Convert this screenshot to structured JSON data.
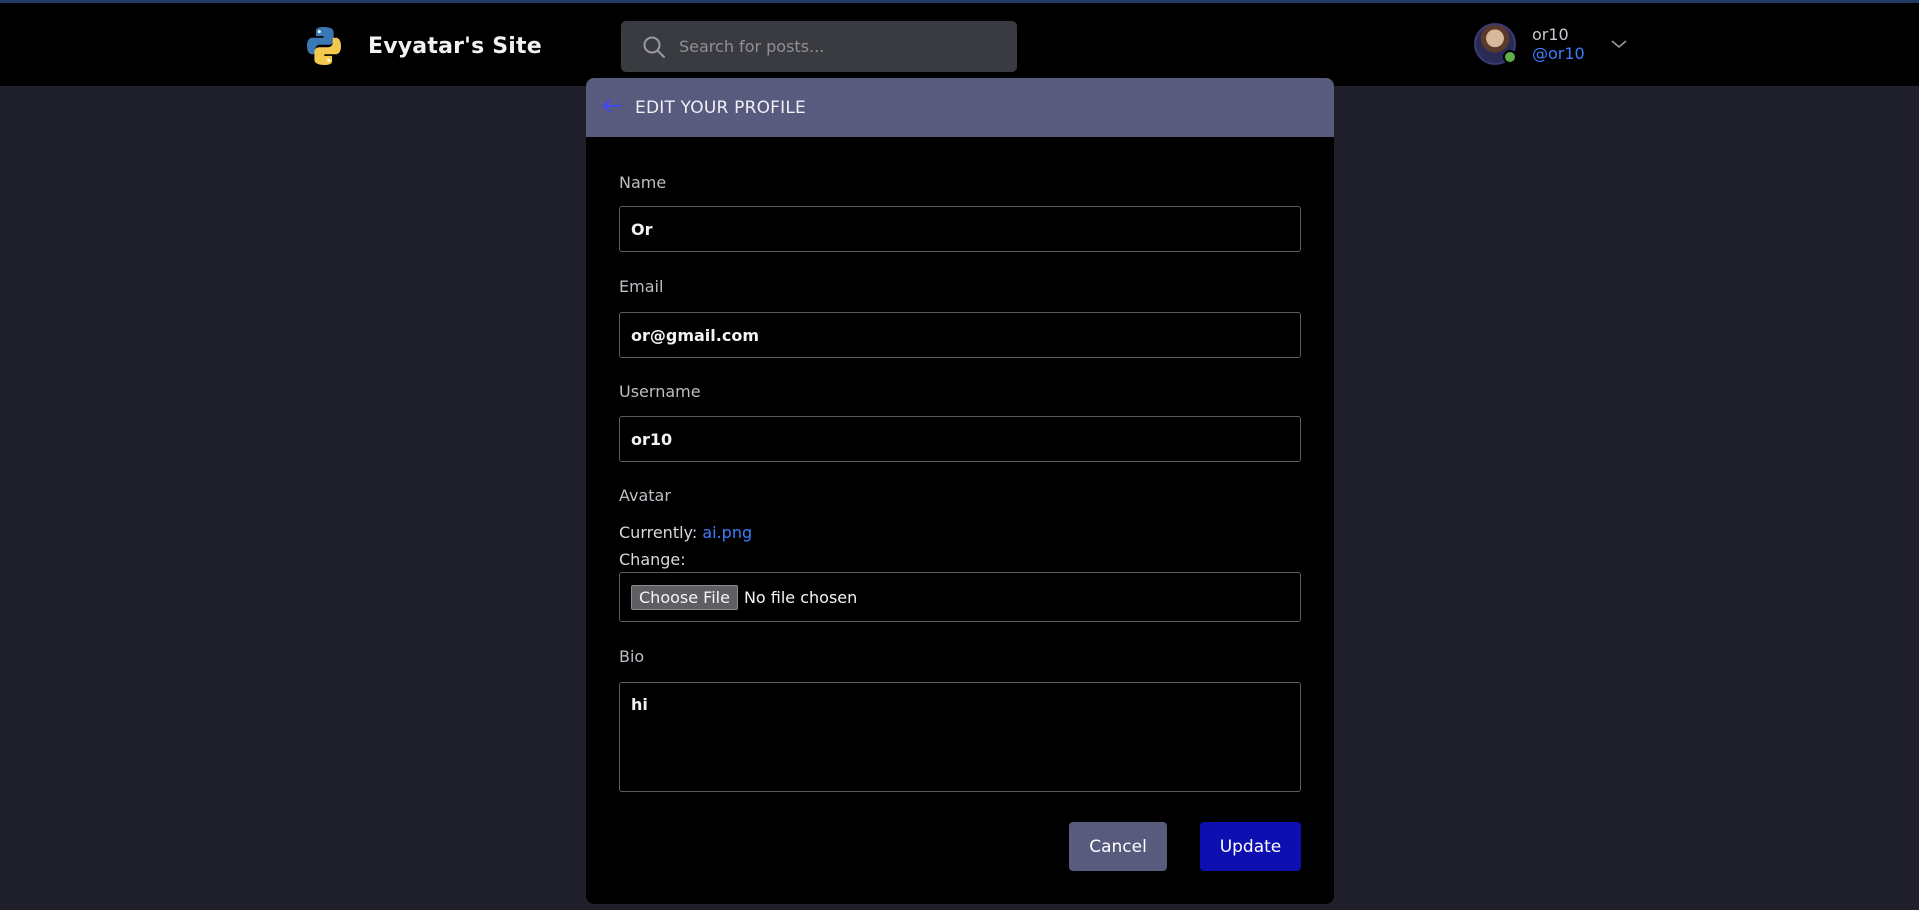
{
  "header": {
    "site_name": "Evyatar's Site",
    "logo_icon": "python-logo-icon",
    "search": {
      "placeholder": "Search for posts...",
      "value": "",
      "icon": "search-icon"
    },
    "user": {
      "name": "or10",
      "handle": "@or10",
      "status": "online",
      "menu_icon": "chevron-down-icon"
    }
  },
  "card": {
    "back_icon": "arrow-left-icon",
    "title": "EDIT YOUR PROFILE",
    "fields": {
      "name_label": "Name",
      "name_value": "Or",
      "email_label": "Email",
      "email_value": "or@gmail.com",
      "username_label": "Username",
      "username_value": "or10",
      "avatar_label": "Avatar",
      "avatar_currently_label": "Currently:",
      "avatar_current_file": "ai.png",
      "avatar_change_label": "Change:",
      "file_button_label": "Choose File",
      "file_status": "No file chosen",
      "bio_label": "Bio",
      "bio_value": "hi"
    },
    "actions": {
      "cancel_label": "Cancel",
      "update_label": "Update"
    }
  },
  "colors": {
    "page_bg": "#20202d",
    "topbar_bg": "#000000",
    "card_header_bg": "#585a7e",
    "accent_link": "#3f7dff",
    "update_button": "#0d0fb0",
    "cancel_button": "#585a7e",
    "online_dot": "#5fae4b"
  }
}
